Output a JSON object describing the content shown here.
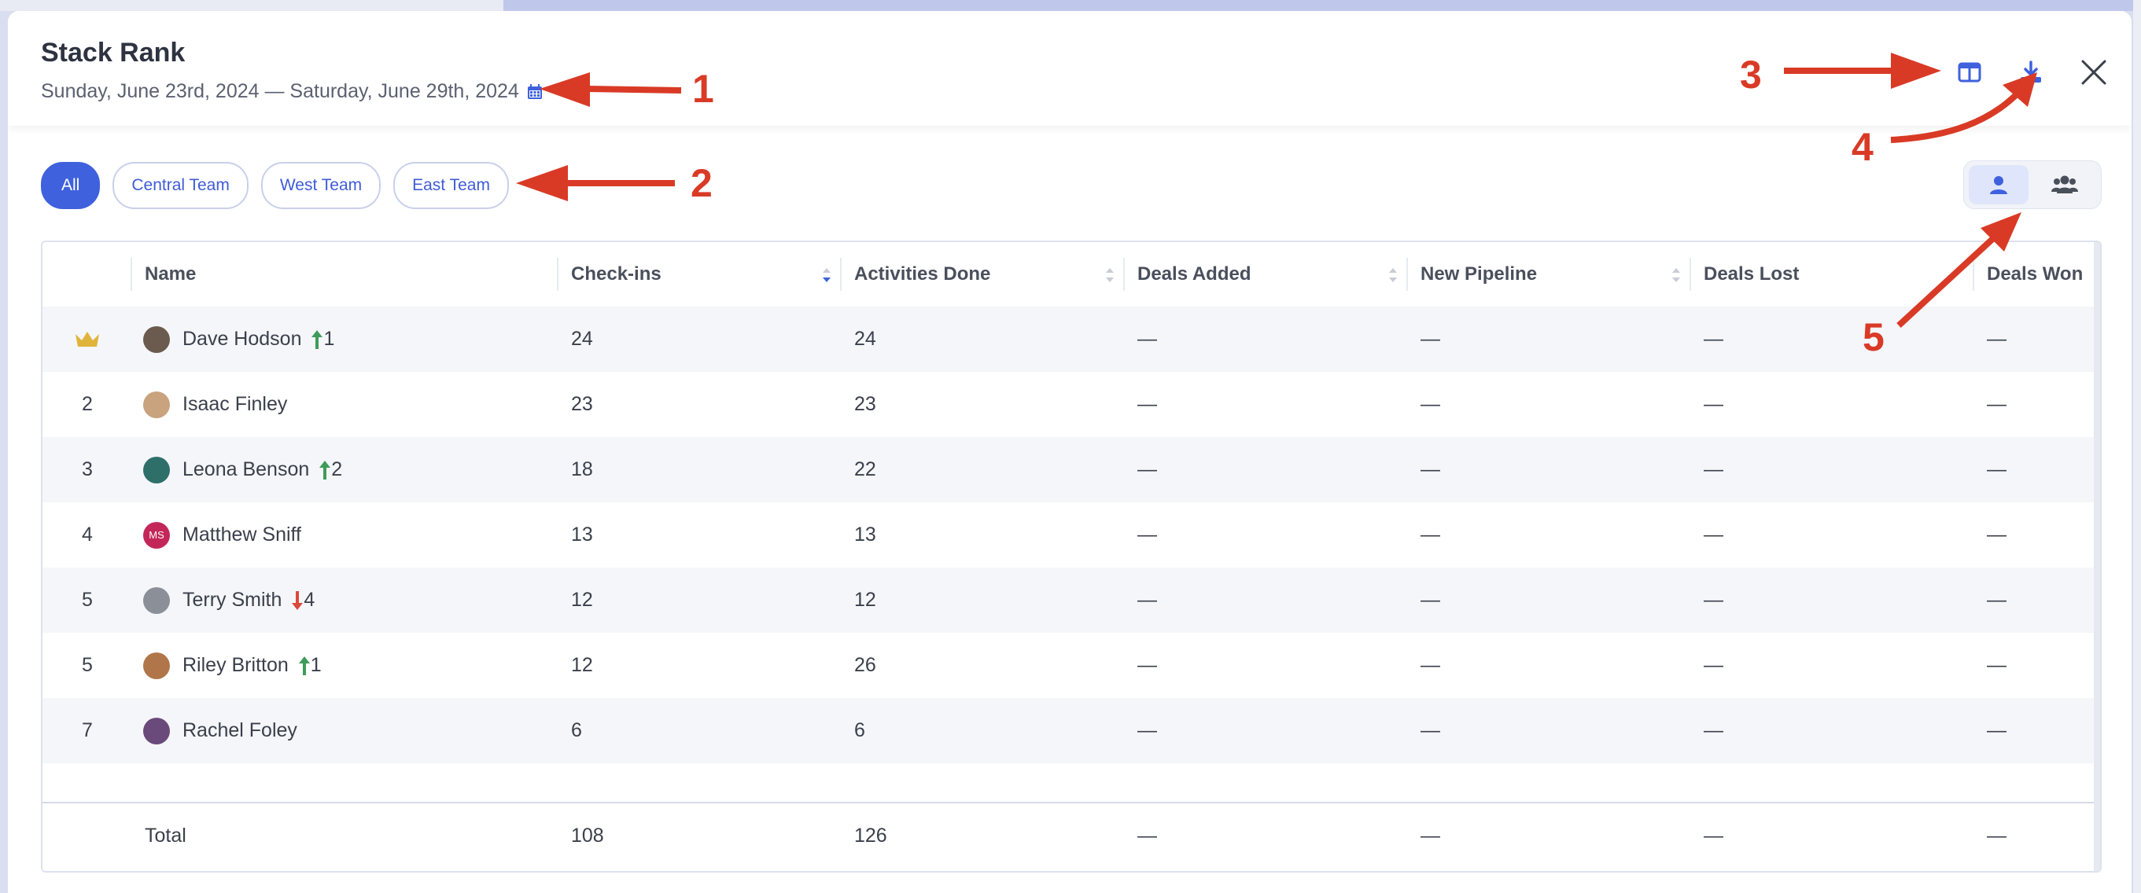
{
  "modal": {
    "title": "Stack Rank",
    "date_range": "Sunday, June 23rd, 2024 — Saturday, June 29th, 2024"
  },
  "header_icons": {
    "calendar": "calendar-icon",
    "columns": "columns-icon",
    "download": "download-icon",
    "close": "close-icon"
  },
  "annotations": [
    "1",
    "2",
    "3",
    "4",
    "5"
  ],
  "filters": {
    "items": [
      "All",
      "Central Team",
      "West Team",
      "East Team"
    ],
    "selected": "All"
  },
  "view_toggle": {
    "options": [
      "individual-view",
      "team-view"
    ],
    "selected": "individual-view"
  },
  "colors": {
    "accent": "#3f61dd",
    "up": "#3f9b5a",
    "down": "#d94a3a",
    "annotation": "#d93a26",
    "crown": "#e0b43a"
  },
  "table": {
    "columns": [
      "Name",
      "Check-ins",
      "Activities Done",
      "Deals Added",
      "New Pipeline",
      "Deals Lost",
      "Deals Won"
    ],
    "rows": [
      {
        "rank": "crown",
        "name": "Dave Hodson",
        "change": "1",
        "direction": "up",
        "checkins": "24",
        "activities": "24",
        "deals_added": "—",
        "new_pipeline": "—",
        "deals_lost": "—",
        "deals_won": "—"
      },
      {
        "rank": "2",
        "name": "Isaac Finley",
        "change": "",
        "direction": "",
        "checkins": "23",
        "activities": "23",
        "deals_added": "—",
        "new_pipeline": "—",
        "deals_lost": "—",
        "deals_won": "—"
      },
      {
        "rank": "3",
        "name": "Leona Benson",
        "change": "2",
        "direction": "up",
        "checkins": "18",
        "activities": "22",
        "deals_added": "—",
        "new_pipeline": "—",
        "deals_lost": "—",
        "deals_won": "—"
      },
      {
        "rank": "4",
        "name": "Matthew Sniff",
        "change": "",
        "direction": "",
        "checkins": "13",
        "activities": "13",
        "deals_added": "—",
        "new_pipeline": "—",
        "deals_lost": "—",
        "deals_won": "—",
        "initials": "MS"
      },
      {
        "rank": "5",
        "name": "Terry Smith",
        "change": "4",
        "direction": "down",
        "checkins": "12",
        "activities": "12",
        "deals_added": "—",
        "new_pipeline": "—",
        "deals_lost": "—",
        "deals_won": "—"
      },
      {
        "rank": "5",
        "name": "Riley Britton",
        "change": "1",
        "direction": "up",
        "checkins": "12",
        "activities": "26",
        "deals_added": "—",
        "new_pipeline": "—",
        "deals_lost": "—",
        "deals_won": "—"
      },
      {
        "rank": "7",
        "name": "Rachel Foley",
        "change": "",
        "direction": "",
        "checkins": "6",
        "activities": "6",
        "deals_added": "—",
        "new_pipeline": "—",
        "deals_lost": "—",
        "deals_won": "—"
      }
    ],
    "total": {
      "label": "Total",
      "checkins": "108",
      "activities": "126",
      "deals_added": "—",
      "new_pipeline": "—",
      "deals_lost": "—",
      "deals_won": "—"
    }
  }
}
